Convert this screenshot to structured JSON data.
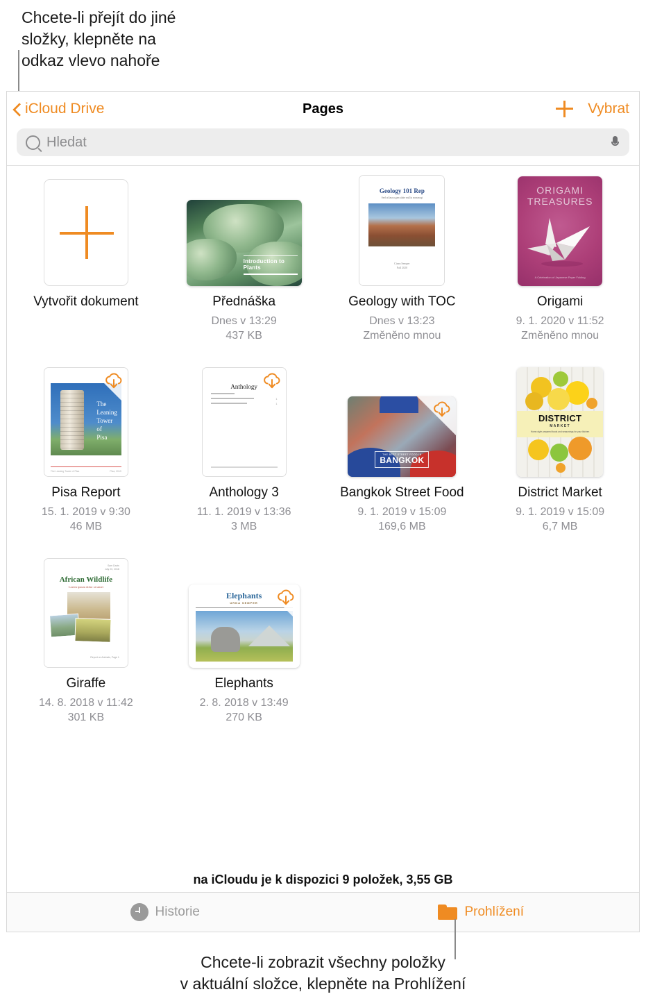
{
  "callouts": {
    "top": "Chcete-li přejít do jiné\nsložky, klepněte na\nodkaz vlevo nahoře",
    "bottom": "Chcete-li zobrazit všechny položky\nv aktuální složce, klepněte na Prohlížení"
  },
  "nav": {
    "back_label": "iCloud Drive",
    "title": "Pages",
    "select_label": "Vybrat",
    "add_icon": "plus-icon",
    "back_icon": "chevron-left-icon"
  },
  "search": {
    "placeholder": "Hledat",
    "value": "",
    "search_icon": "search-icon",
    "mic_icon": "microphone-icon"
  },
  "grid": {
    "create": {
      "label": "Vytvořit dokument",
      "icon": "plus-icon"
    },
    "items": [
      {
        "title": "Přednáška",
        "date": "Dnes v 13:29",
        "detail": "437 KB",
        "cloud": false,
        "thumb_caption": "Introduction\nto Plants",
        "kind": "leaves"
      },
      {
        "title": "Geology with TOC",
        "date": "Dnes v 13:23",
        "detail": "Změněno mnou",
        "cloud": false,
        "thumb_title": "Geology 101 Rep",
        "thumb_sub": "Sed ut'iascu gan ulate nullis nonassqi",
        "thumb_foot": "Cinea Semper\nFall 2020",
        "kind": "geology"
      },
      {
        "title": "Origami",
        "date": "9. 1. 2020 v 11:52",
        "detail": "Změněno mnou",
        "cloud": false,
        "thumb_title": "ORIGAMI\nTREASURES",
        "thumb_foot": "A Celebration of Japanese Paper Folding",
        "kind": "origami"
      },
      {
        "title": "Pisa Report",
        "date": "15. 1. 2019 v 9:30",
        "detail": "46 MB",
        "cloud": true,
        "thumb_text": "The\nLeaning\nTower\nof\nPisa",
        "thumb_cap_left": "The Leaning Tower of Pisa",
        "thumb_cap_right": "Pisa, 2019",
        "kind": "pisa"
      },
      {
        "title": "Anthology 3",
        "date": "11. 1. 2019 v 13:36",
        "detail": "3 MB",
        "cloud": true,
        "thumb_title": "Anthology",
        "kind": "anthology"
      },
      {
        "title": "Bangkok Street Food",
        "date": "9. 1. 2019 v 15:09",
        "detail": "169,6 MB",
        "cloud": true,
        "thumb_small": "THE BEST STREET FOOD IN",
        "thumb_big": "BANGKOK",
        "kind": "bangkok"
      },
      {
        "title": "District Market",
        "date": "9. 1. 2019 v 15:09",
        "detail": "6,7 MB",
        "cloud": false,
        "thumb_title": "DISTRICT",
        "thumb_sub": "MARKET",
        "thumb_sub2": "Home-style prepared foods and seasonings for your kitchen",
        "kind": "district"
      },
      {
        "title": "Giraffe",
        "date": "14. 8. 2018 v 11:42",
        "detail": "301 KB",
        "cloud": false,
        "thumb_head": "Sam Davis\nJuly 20, 2018",
        "thumb_title": "African Wildlife",
        "thumb_sub": "Lorem ipsum dolor sit amet",
        "thumb_foot": "Report on Animals, Page 1",
        "kind": "giraffe"
      },
      {
        "title": "Elephants",
        "date": "2. 8. 2018 v 13:49",
        "detail": "270 KB",
        "cloud": true,
        "thumb_title": "Elephants",
        "thumb_sub": "URNA SEMPER",
        "kind": "elephants"
      }
    ]
  },
  "status": "na iCloudu je k dispozici 9 položek, 3,55 GB",
  "tabbar": {
    "history": {
      "label": "Historie",
      "icon": "clock-icon"
    },
    "browse": {
      "label": "Prohlížení",
      "icon": "folder-icon"
    }
  },
  "colors": {
    "accent": "#ef8b22",
    "muted": "#8e8e93",
    "search_bg": "#ededed"
  }
}
